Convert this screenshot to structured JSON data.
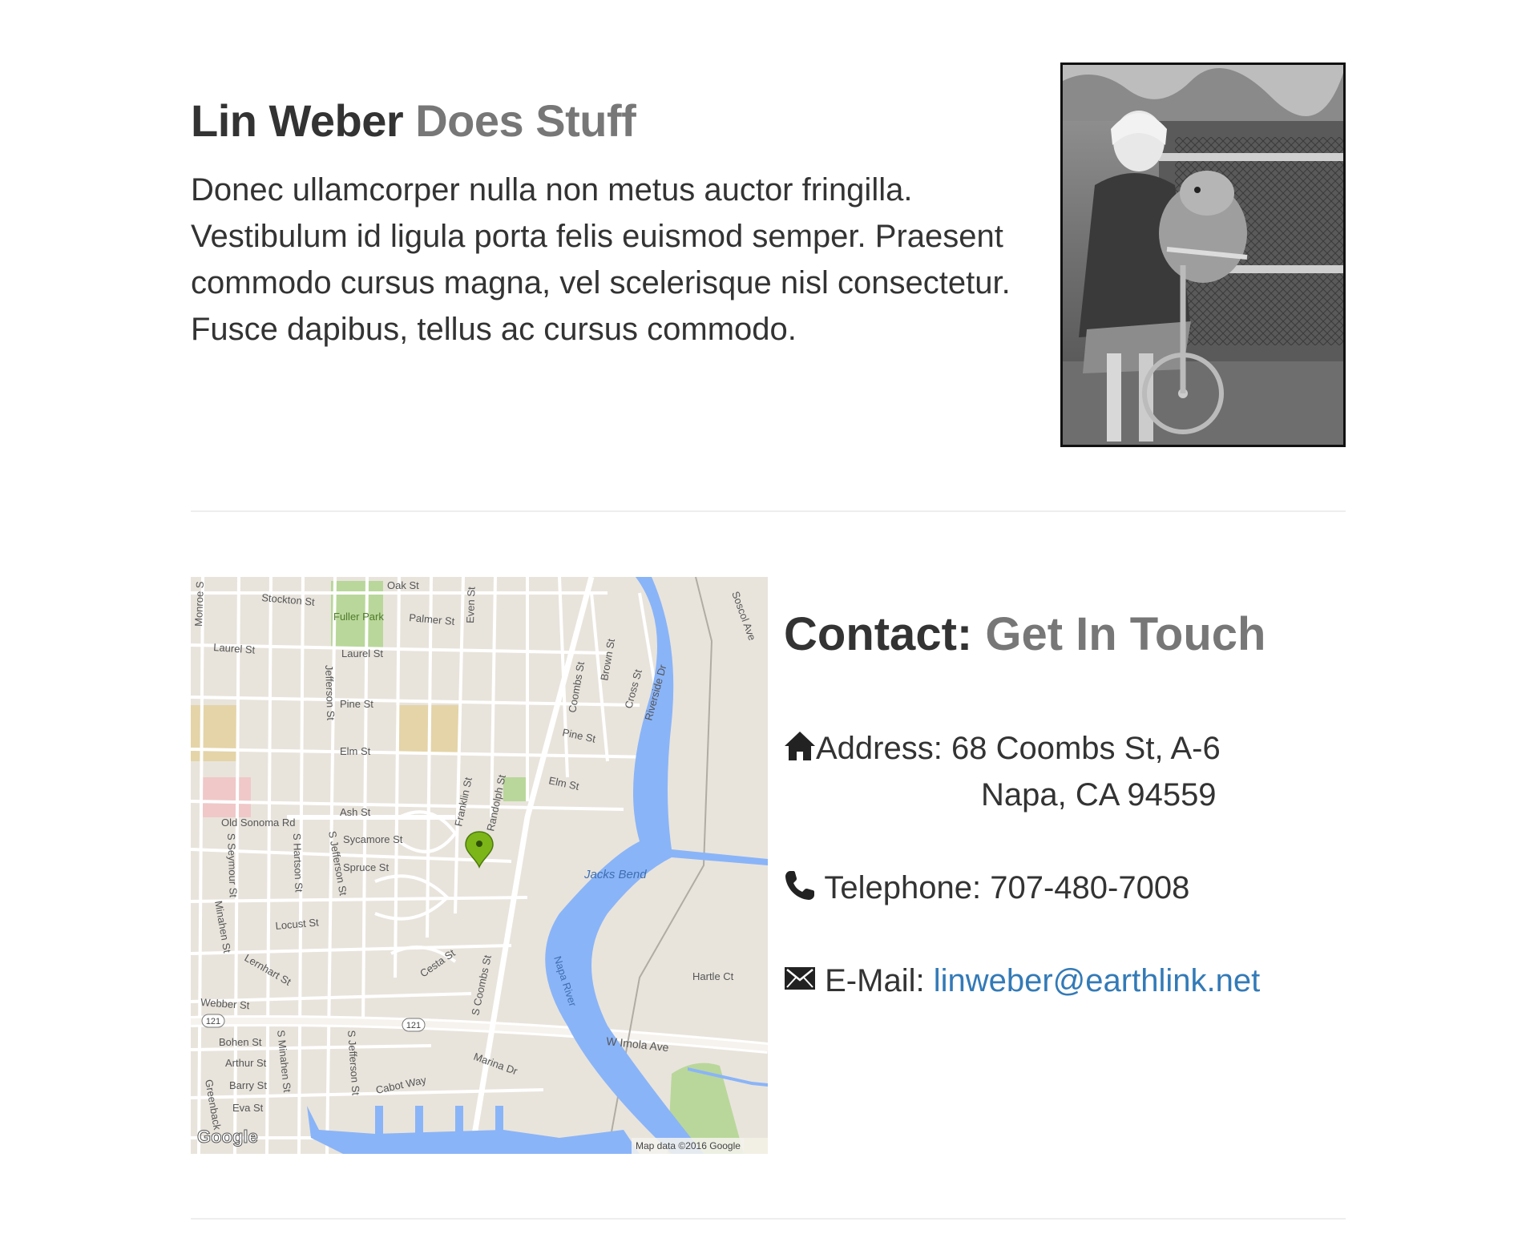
{
  "intro": {
    "title_main": "Lin Weber",
    "title_muted": "Does Stuff",
    "text": "Donec ullamcorper nulla non metus auctor fringilla. Vestibulum id ligula porta felis euismod semper. Praesent commodo cursus magna, vel scelerisque nisl consectetur. Fusce dapibus, tellus ac cursus commodo."
  },
  "contact": {
    "title_main": "Contact:",
    "title_muted": "Get In Touch",
    "address_label": "Address:",
    "address_line1": "68 Coombs St, A-6",
    "address_line2": "Napa, CA 94559",
    "phone_label": "Telephone:",
    "phone": "707-480-7008",
    "email_label": "E-Mail:",
    "email": "linweber@earthlink.net",
    "link_color": "#337ab7"
  },
  "map": {
    "labels": {
      "oak": "Oak St",
      "stockton": "Stockton St",
      "fuller": "Fuller Park",
      "palmer": "Palmer St",
      "even": "Even St",
      "monroe": "Monroe S",
      "laurel1": "Laurel St",
      "laurel2": "Laurel St",
      "soscol": "Soscol Ave",
      "coombs1": "Coombs St",
      "brown": "Brown St",
      "cross": "Cross St",
      "riverside": "Riverside Dr",
      "jefferson1": "Jefferson St",
      "pine1": "Pine St",
      "pine2": "Pine St",
      "elm1": "Elm St",
      "elm2": "Elm St",
      "franklin": "Franklin St",
      "randolph": "Randolph St",
      "ash": "Ash St",
      "oldsonoma": "Old Sonoma Rd",
      "sycamore": "Sycamore St",
      "spruce": "Spruce St",
      "sseymour": "S Seymour St",
      "shartson": "S Hartson St",
      "sjefferson1": "S Jefferson St",
      "jacks": "Jacks Bend",
      "minahen1": "Minahen St",
      "locust": "Locust St",
      "lernhart": "Lernhart St",
      "cesta": "Cesta St",
      "scoombs": "S Coombs St",
      "napariver": "Napa River",
      "hartle": "Hartle Ct",
      "webber": "Webber St",
      "bohen": "Bohen St",
      "arthur": "Arthur St",
      "barry": "Barry St",
      "eva": "Eva St",
      "sminahen": "S Minahen St",
      "greenback": "Greenback",
      "sjefferson2": "S Jefferson St",
      "cabot": "Cabot Way",
      "marina": "Marina Dr",
      "imola": "W Imola Ave",
      "shield1": "121",
      "shield2": "121",
      "google": "Google",
      "attribution": "Map data ©2016 Google"
    }
  },
  "icons": {
    "home": "home-icon",
    "phone": "phone-icon",
    "mail": "envelope-icon",
    "marker": "map-marker-icon"
  }
}
